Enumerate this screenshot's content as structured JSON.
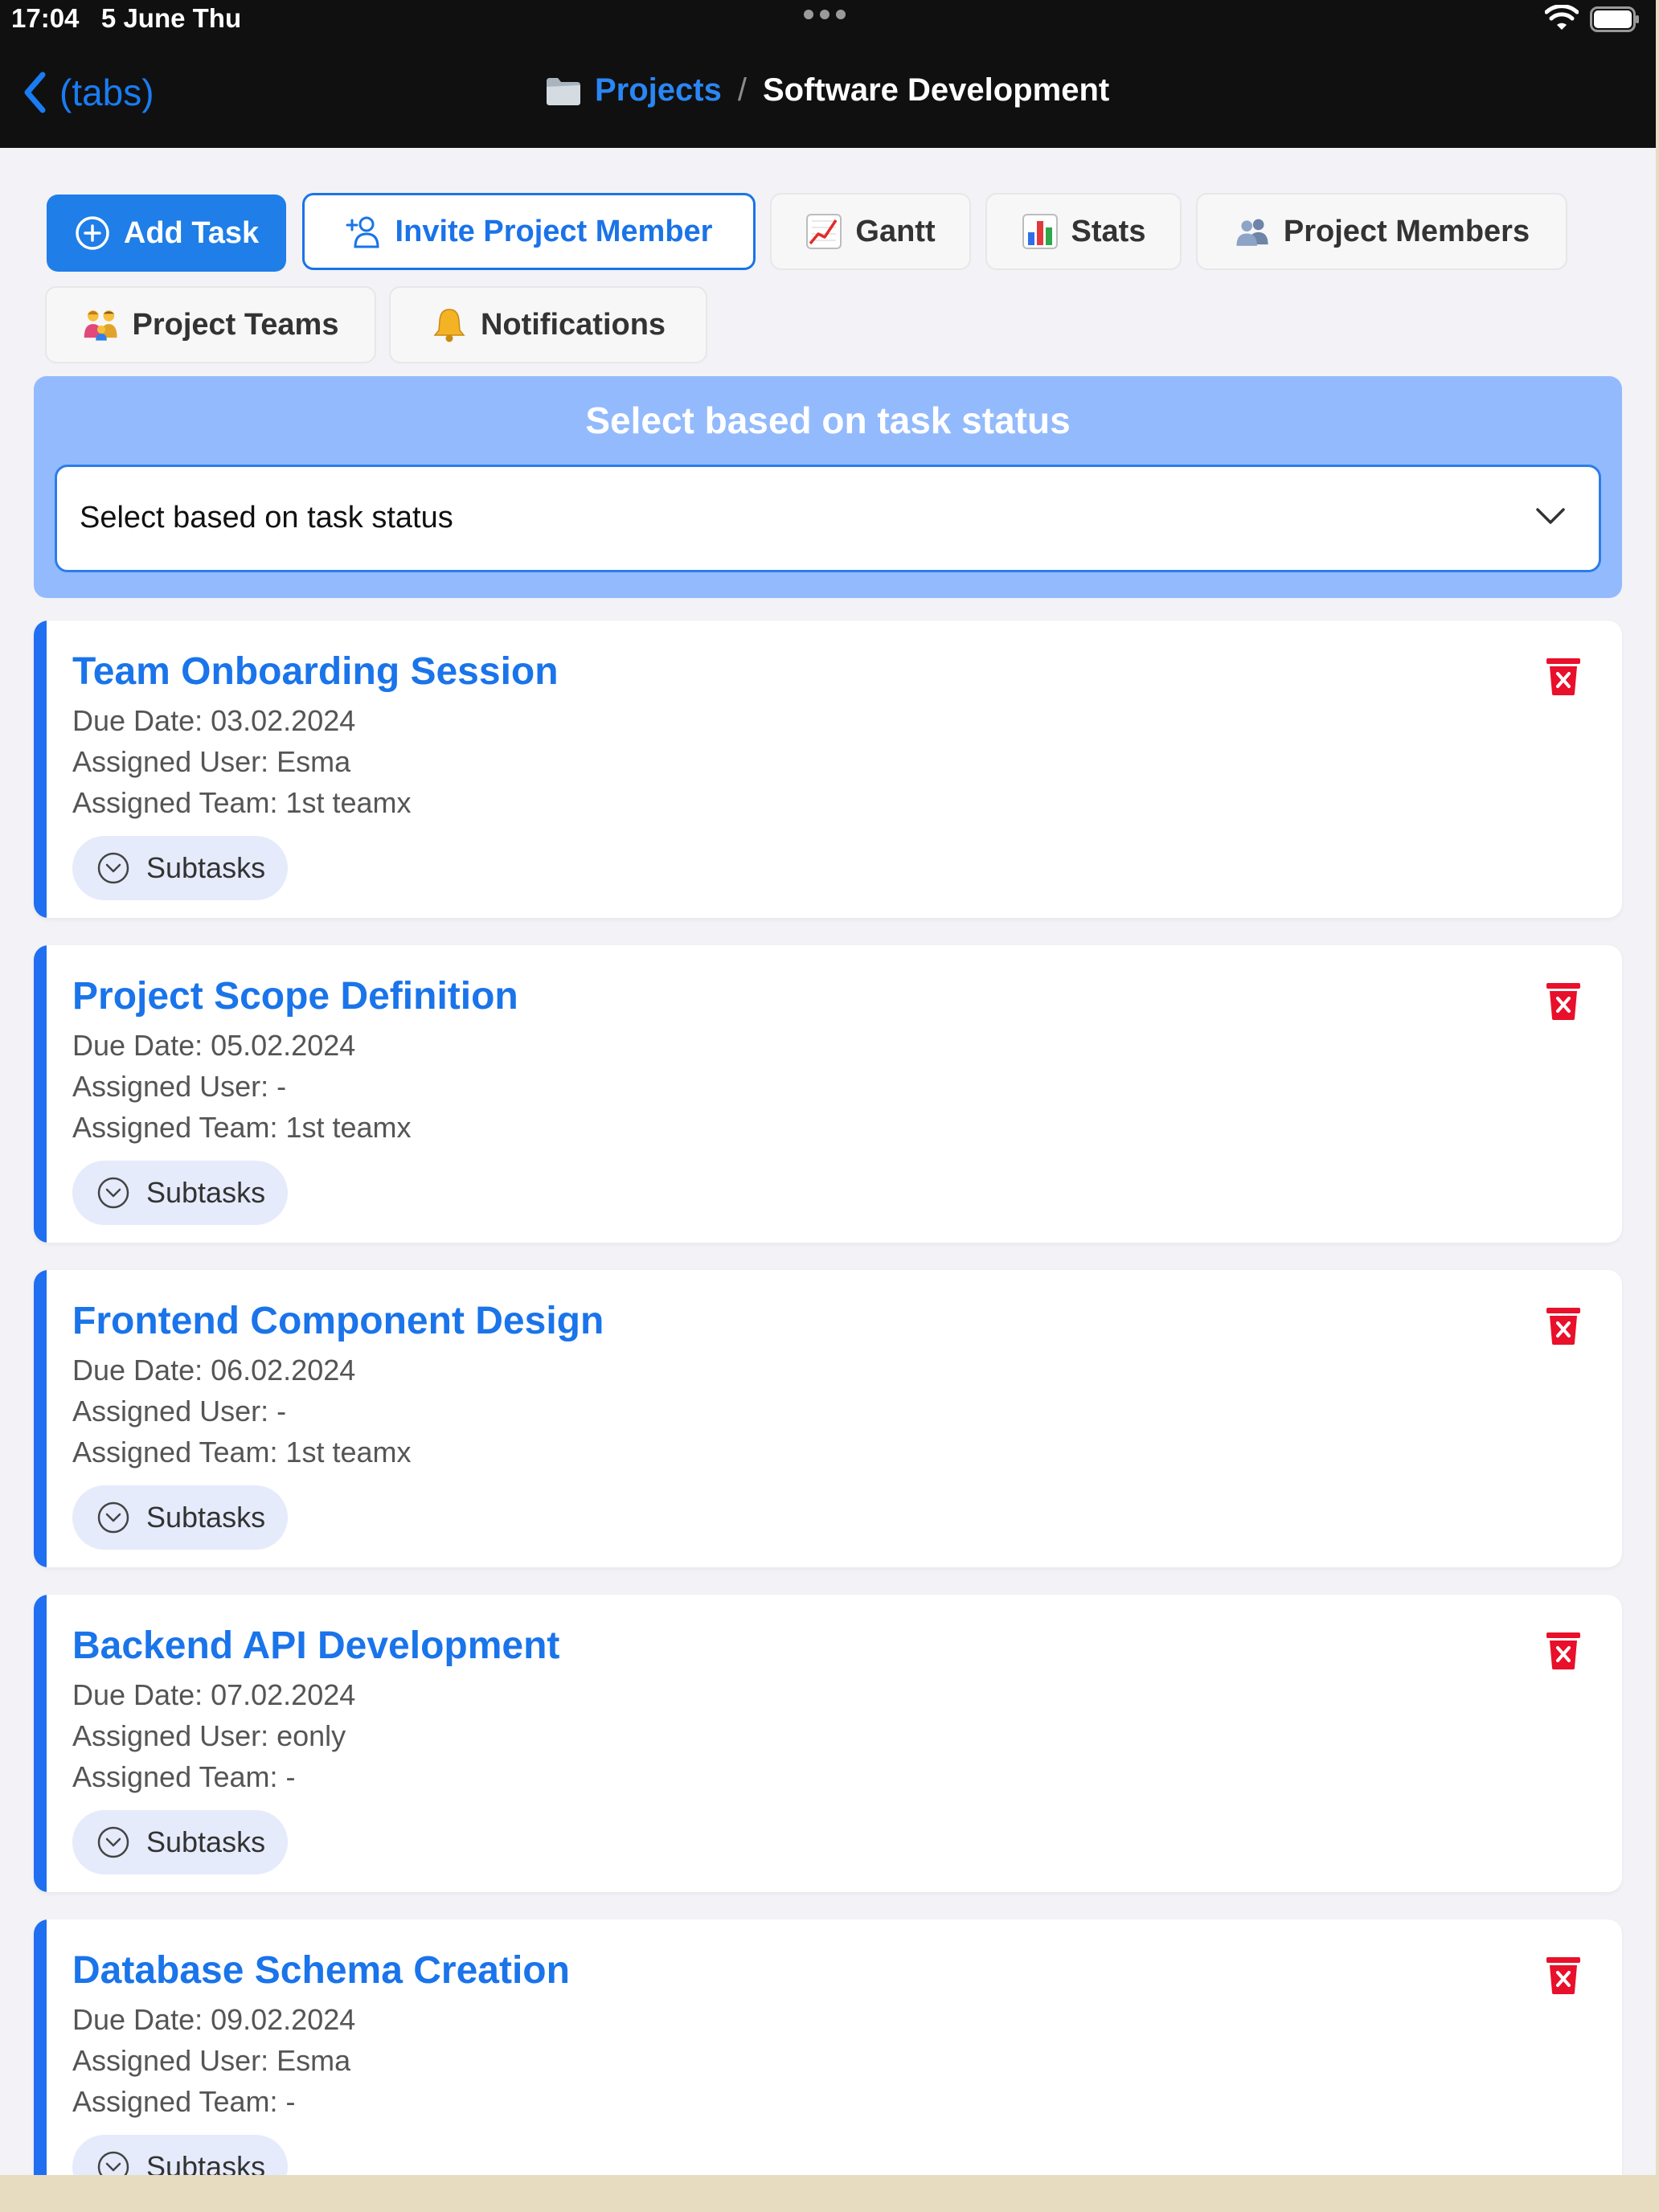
{
  "status_bar": {
    "time": "17:04",
    "date": "5 June Thu"
  },
  "nav": {
    "back_label": "(tabs)",
    "folder_icon": "folder-icon",
    "crumb_parent": "Projects",
    "crumb_separator": "/",
    "crumb_current": "Software Development"
  },
  "toolbar": {
    "add_task": "Add Task",
    "invite_member": "Invite Project Member",
    "gantt": "Gantt",
    "stats": "Stats",
    "project_members": "Project Members",
    "project_teams": "Project Teams",
    "notifications": "Notifications"
  },
  "filter": {
    "title": "Select based on task status",
    "selected": "Select based on task status"
  },
  "tasks": [
    {
      "title": "Team Onboarding Session",
      "due": "Due Date: 03.02.2024",
      "user": "Assigned User: Esma",
      "team": "Assigned Team: 1st teamx",
      "subtasks_label": "Subtasks"
    },
    {
      "title": "Project Scope Definition",
      "due": "Due Date: 05.02.2024",
      "user": "Assigned User: -",
      "team": "Assigned Team: 1st teamx",
      "subtasks_label": "Subtasks"
    },
    {
      "title": "Frontend Component Design",
      "due": "Due Date: 06.02.2024",
      "user": "Assigned User: -",
      "team": "Assigned Team: 1st teamx",
      "subtasks_label": "Subtasks"
    },
    {
      "title": "Backend API Development",
      "due": "Due Date: 07.02.2024",
      "user": "Assigned User: eonly",
      "team": "Assigned Team: -",
      "subtasks_label": "Subtasks"
    },
    {
      "title": "Database Schema Creation",
      "due": "Due Date: 09.02.2024",
      "user": "Assigned User: Esma",
      "team": "Assigned Team: -",
      "subtasks_label": "Subtasks"
    }
  ],
  "colors": {
    "accent": "#1a74ea",
    "delete": "#e8102a",
    "filter_panel": "#93bafc"
  }
}
